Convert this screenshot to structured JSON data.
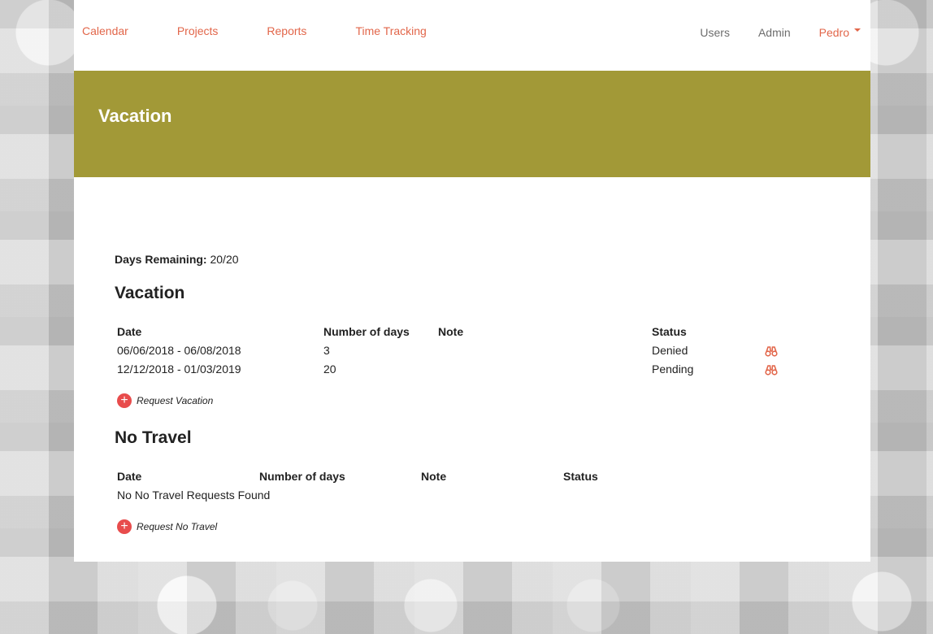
{
  "nav": {
    "left": [
      "Calendar",
      "Projects",
      "Reports",
      "Time Tracking"
    ],
    "users": "Users",
    "admin": "Admin",
    "user_name": "Pedro"
  },
  "banner": {
    "title": "Vacation"
  },
  "summary": {
    "days_label": "Days Remaining:",
    "days_value": "20/20"
  },
  "vacation": {
    "title": "Vacation",
    "headers": {
      "date": "Date",
      "days": "Number of days",
      "note": "Note",
      "status": "Status"
    },
    "rows": [
      {
        "date": "06/06/2018 - 06/08/2018",
        "days": "3",
        "note": "",
        "status": "Denied"
      },
      {
        "date": "12/12/2018 - 01/03/2019",
        "days": "20",
        "note": "",
        "status": "Pending"
      }
    ],
    "request_label": "Request Vacation"
  },
  "no_travel": {
    "title": "No Travel",
    "headers": {
      "date": "Date",
      "days": "Number of days",
      "note": "Note",
      "status": "Status"
    },
    "empty_message": "No No Travel Requests Found",
    "request_label": "Request No Travel"
  },
  "colors": {
    "accent": "#e2664a",
    "banner": "#a29937",
    "plus": "#e84c4c"
  },
  "icons": {
    "view": "binoculars-icon",
    "add": "plus-circle-icon",
    "dropdown": "caret-down-icon"
  }
}
